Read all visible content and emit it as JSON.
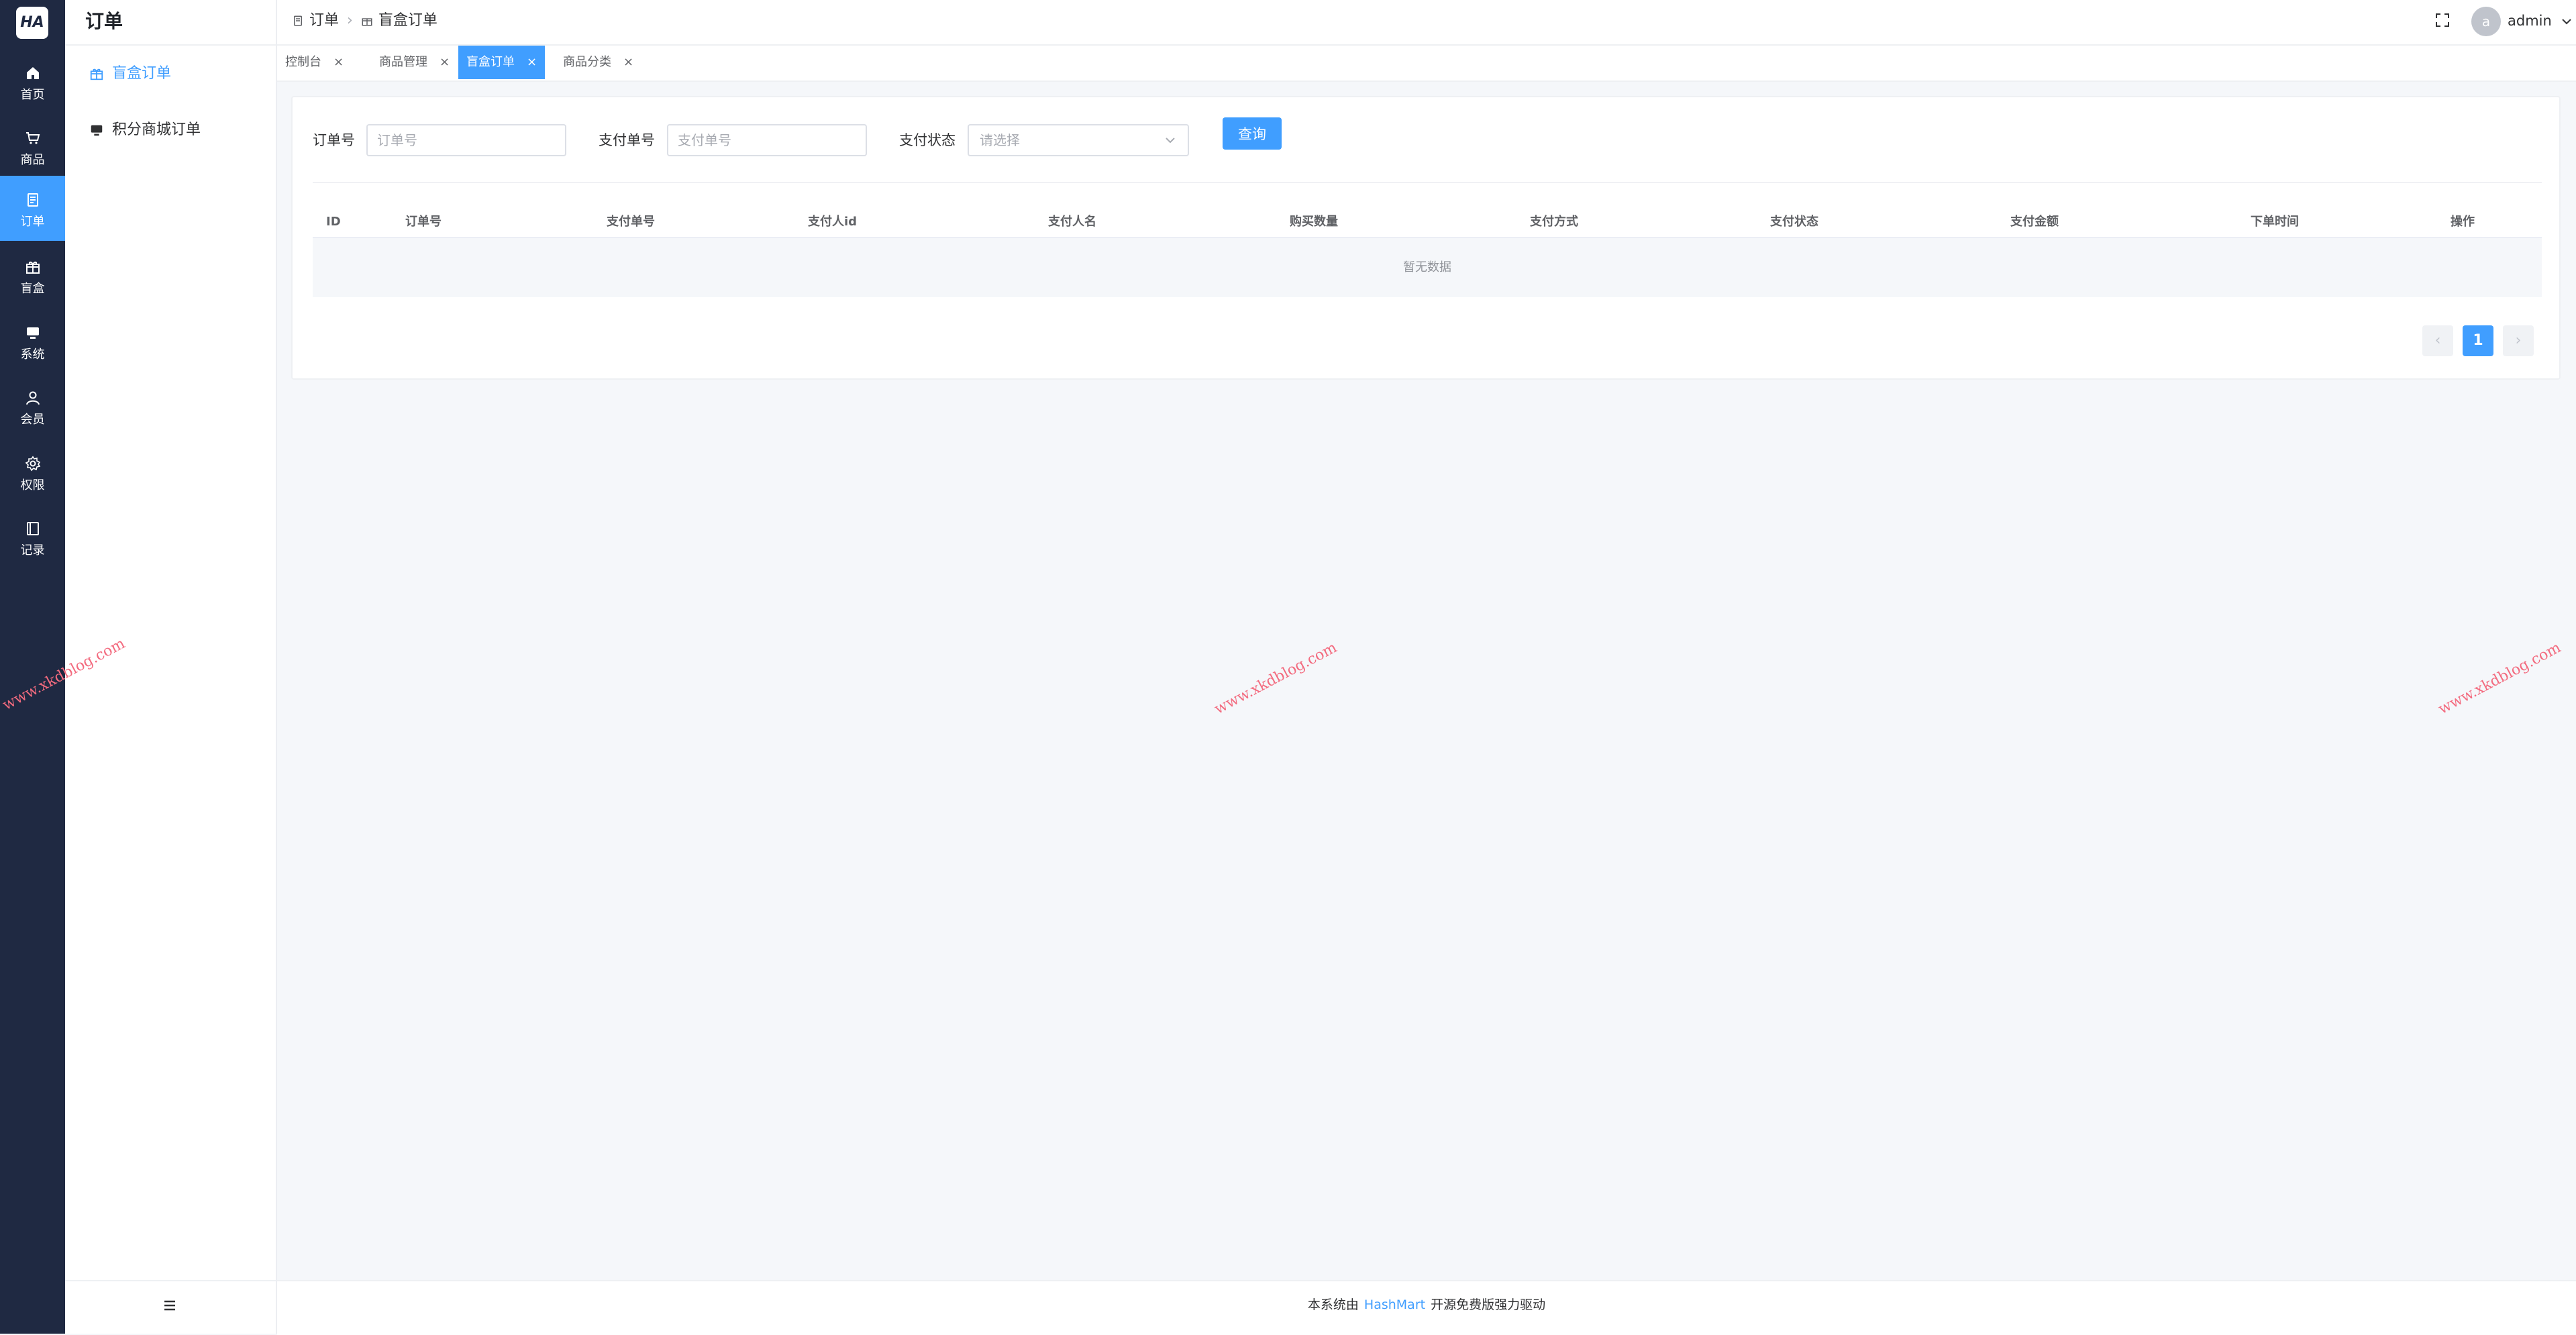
{
  "app": {
    "logo_text": "HA"
  },
  "rail": {
    "items": [
      {
        "label": "首页",
        "icon": "home-icon"
      },
      {
        "label": "商品",
        "icon": "cart-icon"
      },
      {
        "label": "订单",
        "icon": "document-icon",
        "active": true
      },
      {
        "label": "盲盒",
        "icon": "gift-box-icon"
      },
      {
        "label": "系统",
        "icon": "monitor-icon"
      },
      {
        "label": "会员",
        "icon": "user-icon"
      },
      {
        "label": "权限",
        "icon": "gear-icon"
      },
      {
        "label": "记录",
        "icon": "notebook-icon"
      }
    ]
  },
  "submenu": {
    "title": "订单",
    "items": [
      {
        "label": "盲盒订单",
        "icon": "gift-box-icon",
        "active": true
      },
      {
        "label": "积分商城订单",
        "icon": "monitor-icon"
      }
    ]
  },
  "breadcrumb": [
    {
      "label": "订单",
      "icon": "document-icon"
    },
    {
      "label": "盲盒订单",
      "icon": "gift-box-icon"
    }
  ],
  "user": {
    "avatar_letter": "a",
    "name": "admin"
  },
  "tabs": [
    {
      "label": "控制台"
    },
    {
      "label": "商品管理"
    },
    {
      "label": "盲盒订单",
      "active": true
    },
    {
      "label": "商品分类"
    }
  ],
  "filters": {
    "order_no": {
      "label": "订单号",
      "placeholder": "订单号"
    },
    "pay_no": {
      "label": "支付单号",
      "placeholder": "支付单号"
    },
    "pay_status": {
      "label": "支付状态",
      "placeholder": "请选择"
    },
    "query_button": "查询"
  },
  "table": {
    "columns": [
      "ID",
      "订单号",
      "支付单号",
      "支付人id",
      "支付人名",
      "购买数量",
      "支付方式",
      "支付状态",
      "支付金额",
      "下单时间",
      "操作"
    ],
    "empty_text": "暂无数据"
  },
  "pagination": {
    "prev": "‹",
    "current": "1",
    "next": "›"
  },
  "watermark": "www.xkdblog.com",
  "footer": {
    "prefix": "本系统由",
    "link": "HashMart",
    "suffix": "开源免费版强力驱动"
  },
  "colors": {
    "primary": "#409eff",
    "rail_bg": "#1f2942",
    "watermark": "#f36b7f"
  }
}
